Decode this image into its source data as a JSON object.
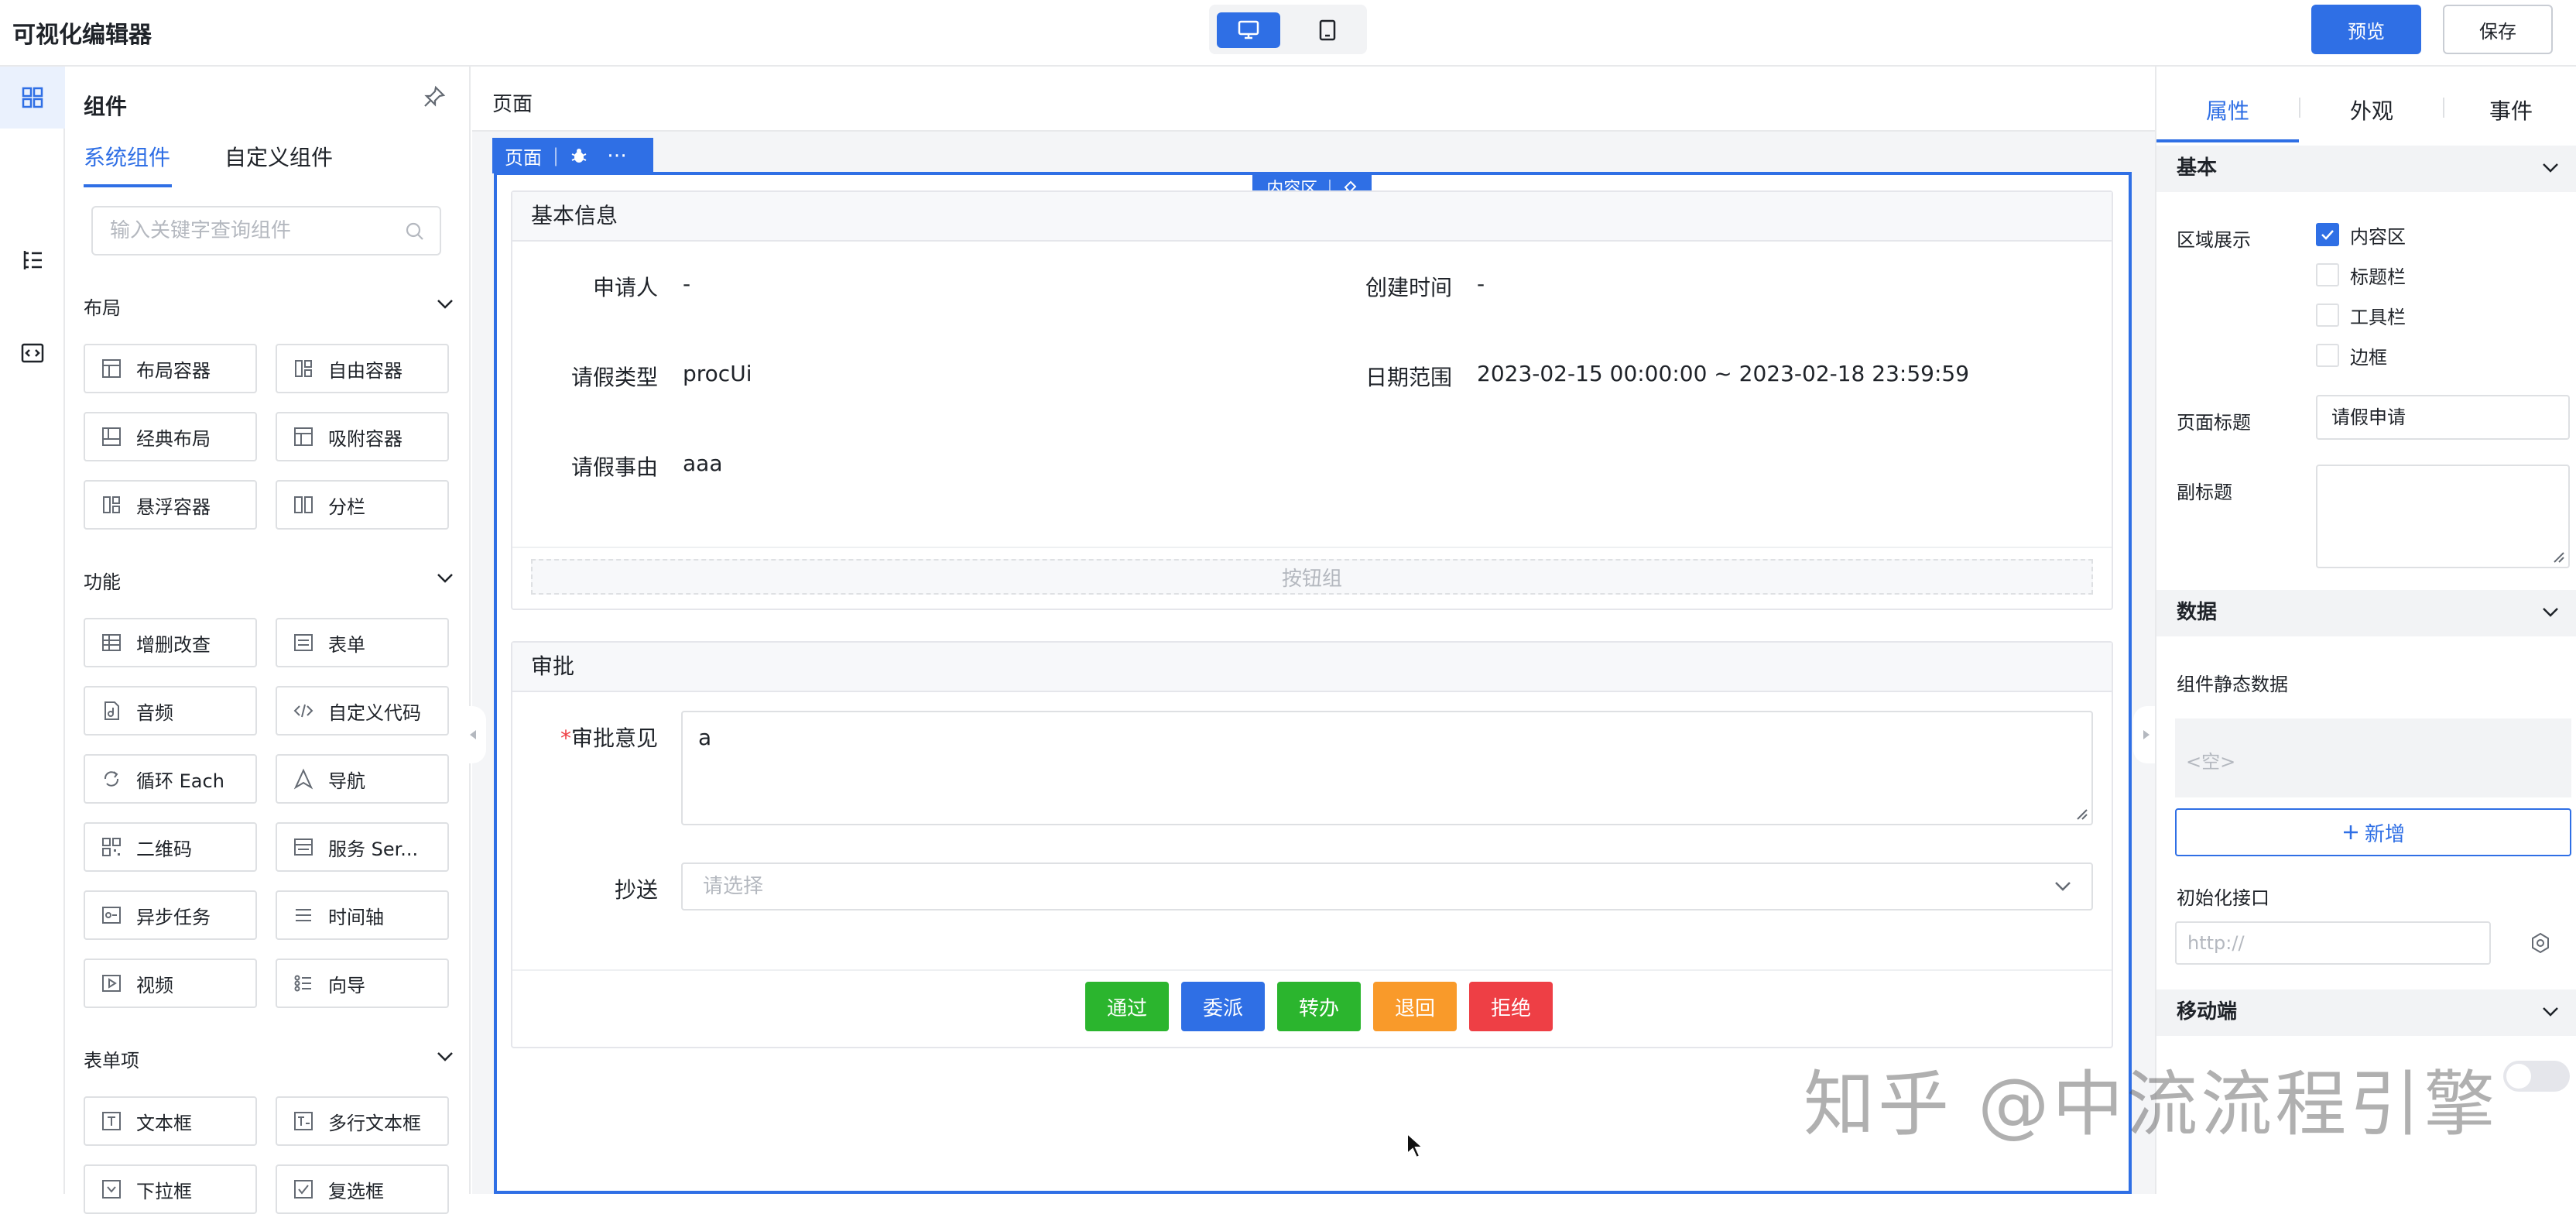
{
  "app": {
    "title": "可视化编辑器",
    "preview_label": "预览",
    "save_label": "保存"
  },
  "devices": [
    {
      "icon": "desktop-icon",
      "active": true
    },
    {
      "icon": "tablet-icon",
      "active": false
    }
  ],
  "rail": [
    "components-icon",
    "outline-tree-icon",
    "code-icon"
  ],
  "components_panel": {
    "title": "组件",
    "tabs": [
      {
        "label": "系统组件",
        "active": true
      },
      {
        "label": "自定义组件",
        "active": false
      }
    ],
    "search_placeholder": "输入关键字查询组件",
    "sections": [
      {
        "title": "布局",
        "items": [
          "布局容器",
          "自由容器",
          "经典布局",
          "吸附容器",
          "悬浮容器",
          "分栏"
        ]
      },
      {
        "title": "功能",
        "items": [
          "增删改查",
          "表单",
          "音频",
          "自定义代码",
          "循环 Each",
          "导航",
          "二维码",
          "服务 Ser...",
          "异步任务",
          "时间轴",
          "视频",
          "向导"
        ]
      },
      {
        "title": "表单项",
        "items": [
          "文本框",
          "多行文本框",
          "下拉框",
          "复选框"
        ]
      }
    ]
  },
  "canvas": {
    "breadcrumb": "页面",
    "page_tag": "页面",
    "content_tag": "内容区",
    "basic_info": {
      "title": "基本信息",
      "fields": [
        {
          "label": "申请人",
          "value": "-"
        },
        {
          "label": "创建时间",
          "value": "-"
        },
        {
          "label": "请假类型",
          "value": "procUi"
        },
        {
          "label": "日期范围",
          "value": "2023-02-15 00:00:00 ~ 2023-02-18 23:59:59"
        },
        {
          "label": "请假事由",
          "value": "aaa"
        }
      ],
      "button_group_placeholder": "按钮组"
    },
    "approval": {
      "title": "审批",
      "opinion_label": "审批意见",
      "opinion_value": "a",
      "cc_label": "抄送",
      "cc_placeholder": "请选择",
      "actions": [
        {
          "label": "通过",
          "color": "#2bb52e"
        },
        {
          "label": "委派",
          "color": "#2f6fe5"
        },
        {
          "label": "转办",
          "color": "#2bb52e"
        },
        {
          "label": "退回",
          "color": "#f99a2a"
        },
        {
          "label": "拒绝",
          "color": "#ee3f45"
        }
      ]
    }
  },
  "props_panel": {
    "tabs": [
      {
        "label": "属性",
        "active": true
      },
      {
        "label": "外观",
        "active": false
      },
      {
        "label": "事件",
        "active": false
      }
    ],
    "basic": {
      "title": "基本",
      "region_label": "区域展示",
      "regions": [
        {
          "label": "内容区",
          "checked": true
        },
        {
          "label": "标题栏",
          "checked": false
        },
        {
          "label": "工具栏",
          "checked": false
        },
        {
          "label": "边框",
          "checked": false
        }
      ],
      "page_title_label": "页面标题",
      "page_title_value": "请假申请",
      "subtitle_label": "副标题"
    },
    "data": {
      "title": "数据",
      "static_data_label": "组件静态数据",
      "static_data_empty": "<空>",
      "add_label": "新增",
      "init_api_label": "初始化接口",
      "init_api_placeholder": "http://"
    },
    "mobile": {
      "title": "移动端",
      "toggle_on": false
    }
  },
  "watermark": "知乎 @中流流程引擎",
  "colors": {
    "accent": "#2f6fe5",
    "border": "#dee0e3",
    "success": "#2bb52e",
    "warning": "#f99a2a",
    "danger": "#ee3f45"
  }
}
